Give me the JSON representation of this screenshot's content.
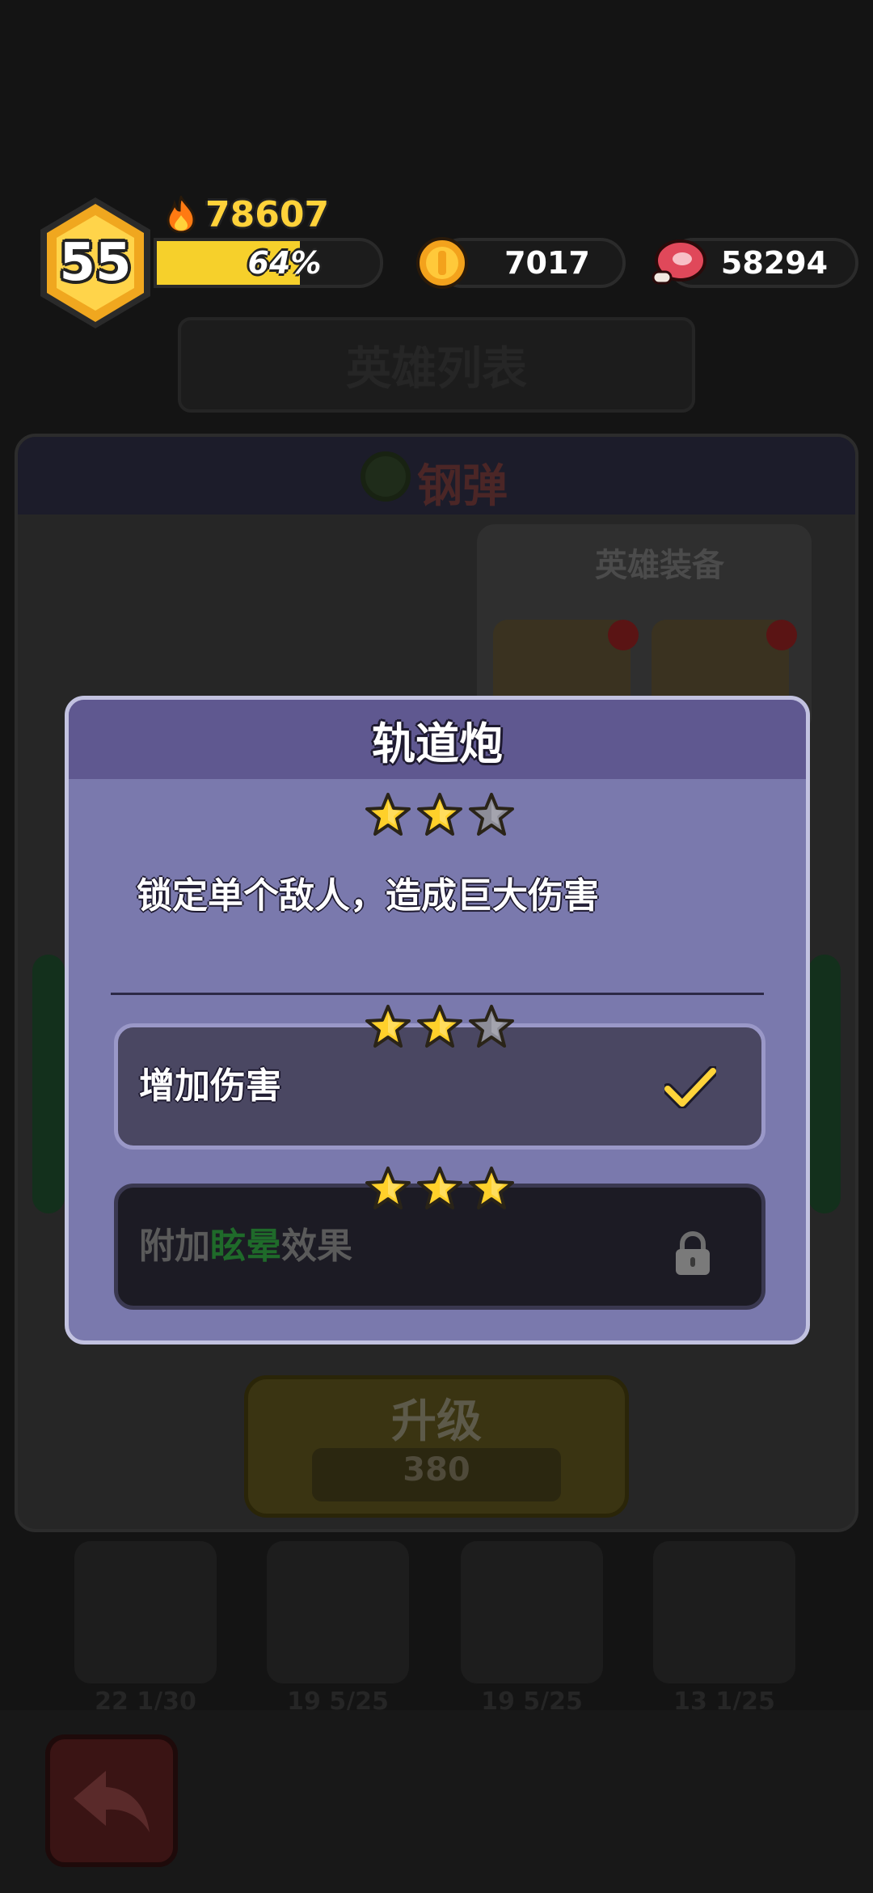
{
  "hud": {
    "level": "55",
    "power": "78607",
    "xp_text": "64%",
    "xp_fraction": 0.64,
    "coins": "7017",
    "meat": "58294"
  },
  "background": {
    "screen_title": "英雄列表",
    "hero_name": "钢弹",
    "equipment_label": "英雄装备",
    "upgrade_label": "升级",
    "upgrade_cost": "380",
    "hero_cards": [
      {
        "stat": "22 1/30"
      },
      {
        "stat": "19 5/25"
      },
      {
        "stat": "19 5/25"
      },
      {
        "stat": "13 1/25"
      }
    ]
  },
  "modal": {
    "title": "轨道炮",
    "stars_filled": 2,
    "stars_total": 3,
    "description": "锁定单个敌人，造成巨大伤害",
    "options": [
      {
        "label": "增加伤害",
        "stars_filled": 2,
        "stars_total": 3,
        "state": "unlocked",
        "icon": "check-icon"
      },
      {
        "label_parts": [
          "附加",
          "眩晕",
          "效果"
        ],
        "stars_filled": 3,
        "stars_total": 3,
        "state": "locked",
        "icon": "lock-icon"
      }
    ]
  },
  "colors": {
    "gold": "#f6d02b",
    "modal_body": "#7a79ad",
    "modal_header": "#5f5890",
    "star": "#ffd02a"
  }
}
